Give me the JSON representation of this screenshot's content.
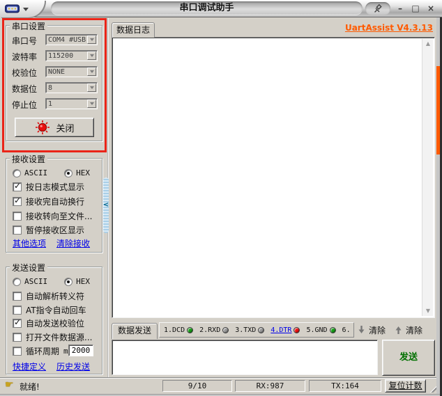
{
  "window": {
    "title": "串口调试助手"
  },
  "icons": {
    "minimize": "–",
    "maximize": "□",
    "close": "×",
    "scroll_up": "▲",
    "scroll_down": "▼",
    "hand": "☛",
    "collapse_left": "<"
  },
  "colors": {
    "annotation": "#ea2418",
    "version_link": "#ff5a00",
    "link": "#0000e8",
    "send_button_text": "#007000",
    "splitter_handle": "#a9cfe8"
  },
  "serial": {
    "group_title": "串口设置",
    "fields_disabled": true,
    "fields": [
      {
        "label": "串口号",
        "value": "COM4 #USB"
      },
      {
        "label": "波特率",
        "value": "115200"
      },
      {
        "label": "校验位",
        "value": "NONE"
      },
      {
        "label": "数据位",
        "value": "8"
      },
      {
        "label": "停止位",
        "value": "1"
      }
    ],
    "toggle_button_label": "关闭"
  },
  "receive": {
    "group_title": "接收设置",
    "radios": [
      {
        "label": "ASCII",
        "selected": false
      },
      {
        "label": "HEX",
        "selected": true
      }
    ],
    "options": [
      {
        "label": "按日志模式显示",
        "checked": true
      },
      {
        "label": "接收完自动换行",
        "checked": true
      },
      {
        "label": "接收转向至文件...",
        "checked": false
      },
      {
        "label": "暂停接收区显示",
        "checked": false
      }
    ],
    "links": [
      {
        "label": "其他选项"
      },
      {
        "label": "清除接收"
      }
    ]
  },
  "send": {
    "group_title": "发送设置",
    "radios": [
      {
        "label": "ASCII",
        "selected": false
      },
      {
        "label": "HEX",
        "selected": true
      }
    ],
    "options": [
      {
        "label": "自动解析转义符",
        "checked": false
      },
      {
        "label": "AT指令自动回车",
        "checked": false
      },
      {
        "label": "自动发送校验位",
        "checked": true
      },
      {
        "label": "打开文件数据源...",
        "checked": false
      }
    ],
    "cycle": {
      "checked": false,
      "label": "循环周期",
      "value": "2000",
      "unit": "ms"
    },
    "links": [
      {
        "label": "快捷定义"
      },
      {
        "label": "历史发送"
      }
    ]
  },
  "version_link": "UartAssist V4.3.13",
  "log_panel": {
    "tab_label": "数据日志",
    "content": ""
  },
  "send_panel": {
    "tab_label": "数据发送",
    "pins": [
      {
        "label": "1.DCD",
        "led": "#18a018",
        "link": false
      },
      {
        "label": "2.RXD",
        "led": "#9a9a9a",
        "link": false
      },
      {
        "label": "3.TXD",
        "led": "#9a9a9a",
        "link": false
      },
      {
        "label": "4.DTR",
        "led": "#f01010",
        "link": true
      },
      {
        "label": "5.GND",
        "led": "#18a018",
        "link": false
      },
      {
        "label": "6.",
        "led": null,
        "link": false
      }
    ],
    "clear_receive_label": "清除",
    "clear_send_label": "清除",
    "input_value": "",
    "send_button_label": "发送"
  },
  "status_bar": {
    "ready": "就绪!",
    "progress": "9/10",
    "rx": "RX:987",
    "tx": "TX:164",
    "reset_button": "复位计数"
  }
}
